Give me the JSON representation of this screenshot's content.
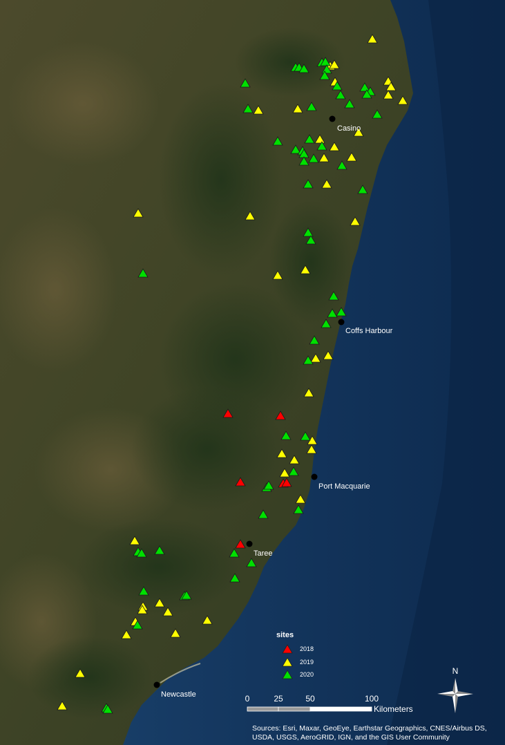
{
  "map": {
    "cities": [
      {
        "name": "Casino"
      },
      {
        "name": "Coffs Harbour"
      },
      {
        "name": "Port Macquarie"
      },
      {
        "name": "Taree"
      },
      {
        "name": "Newcastle"
      }
    ],
    "legend": {
      "title": "sites",
      "items": [
        {
          "label": "2018",
          "color": "#ff0000"
        },
        {
          "label": "2019",
          "color": "#ffff00"
        },
        {
          "label": "2020",
          "color": "#00e000"
        }
      ]
    },
    "scalebar": {
      "ticks": [
        "0",
        "25",
        "50",
        "100"
      ],
      "unit": "Kilometers"
    },
    "north_arrow": {
      "label": "N"
    },
    "attribution": "Sources: Esri, Maxar, GeoEye, Earthstar Geographics, CNES/Airbus DS, USDA, USGS, AeroGRID, IGN, and the GIS User Community"
  }
}
